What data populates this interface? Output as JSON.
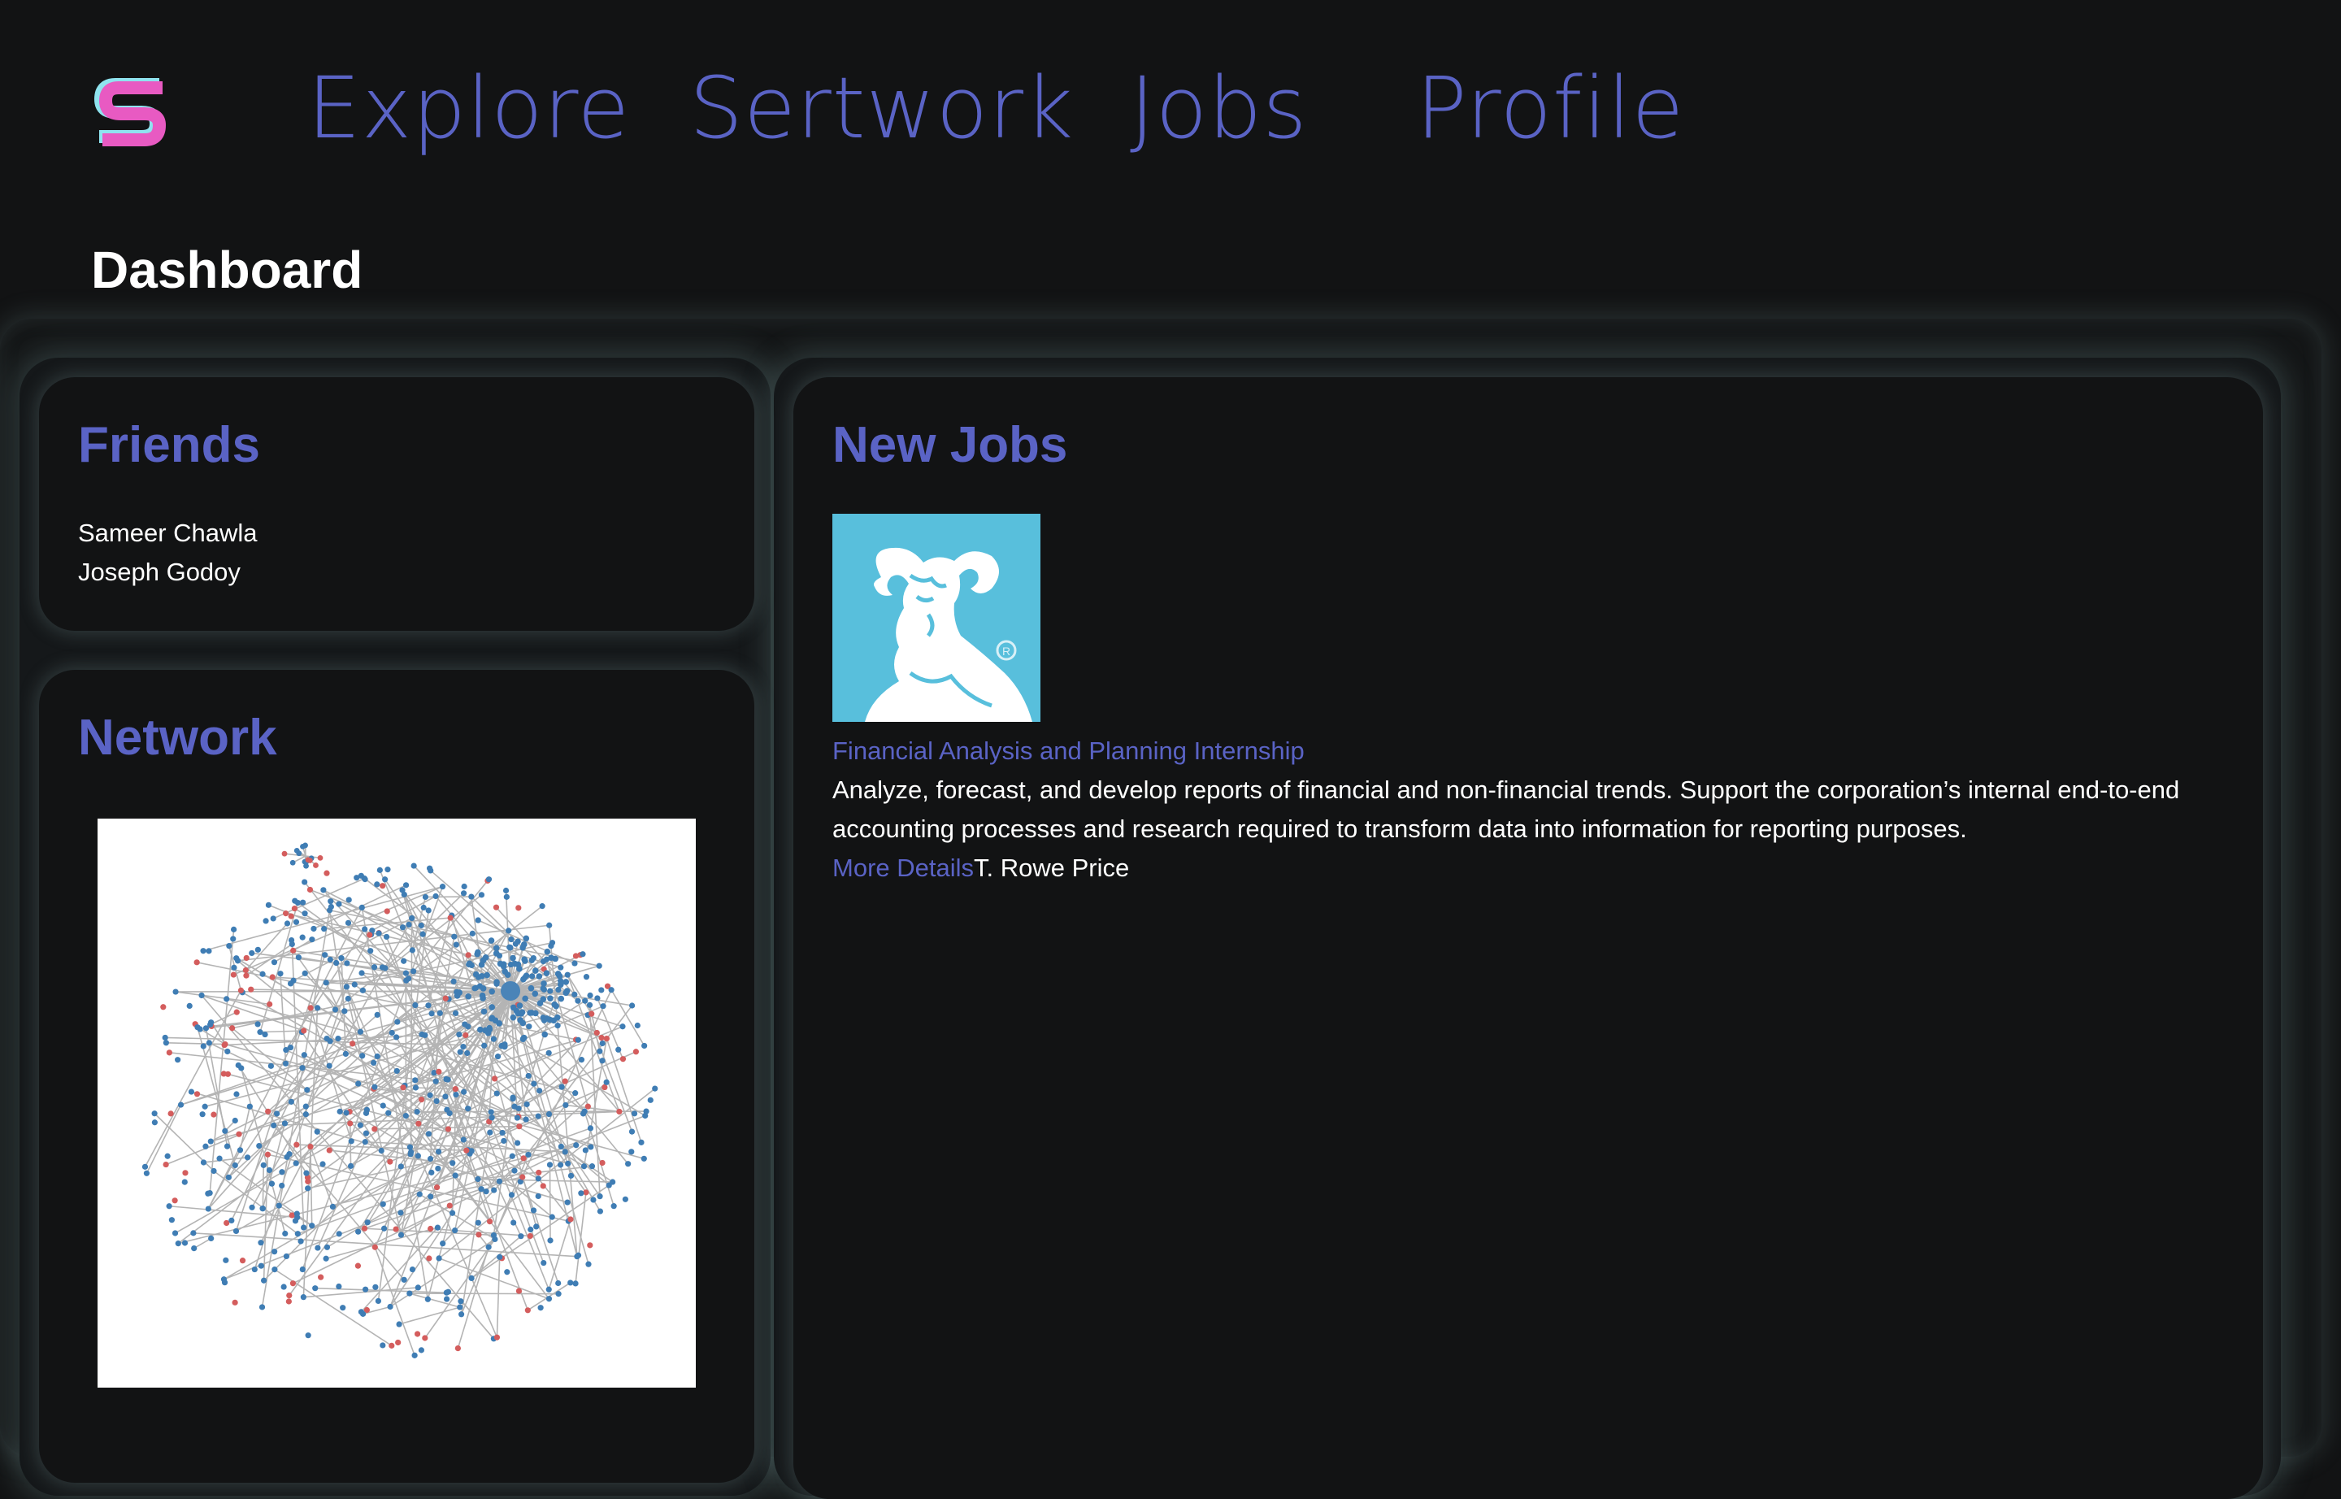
{
  "nav": {
    "logo": "sertwork-s-logo",
    "links": [
      "Explore",
      "Sertwork",
      "Jobs",
      "Profile"
    ]
  },
  "page_title": "Dashboard",
  "friends": {
    "title": "Friends",
    "items": [
      "Sameer Chawla",
      "Joseph Godoy"
    ]
  },
  "network": {
    "title": "Network",
    "image": "network-graph"
  },
  "jobs": {
    "title": "New Jobs",
    "items": [
      {
        "logo": "ram-logo",
        "title": "Financial Analysis and Planning Internship",
        "description": "Analyze, forecast, and develop reports of financial and non-financial trends. Support the corporation’s internal end-to-end accounting processes and research required to transform data into information for reporting purposes.",
        "more_label": "More Details",
        "company": "T. Rowe Price"
      }
    ]
  },
  "colors": {
    "background": "#121314",
    "accent": "#5a63c5",
    "logo_pink": "#e85ac2",
    "logo_cyan": "#8fe3ef",
    "job_logo_bg": "#58bfdc",
    "node_blue": "#3f7db4",
    "node_red": "#d45d5d"
  }
}
